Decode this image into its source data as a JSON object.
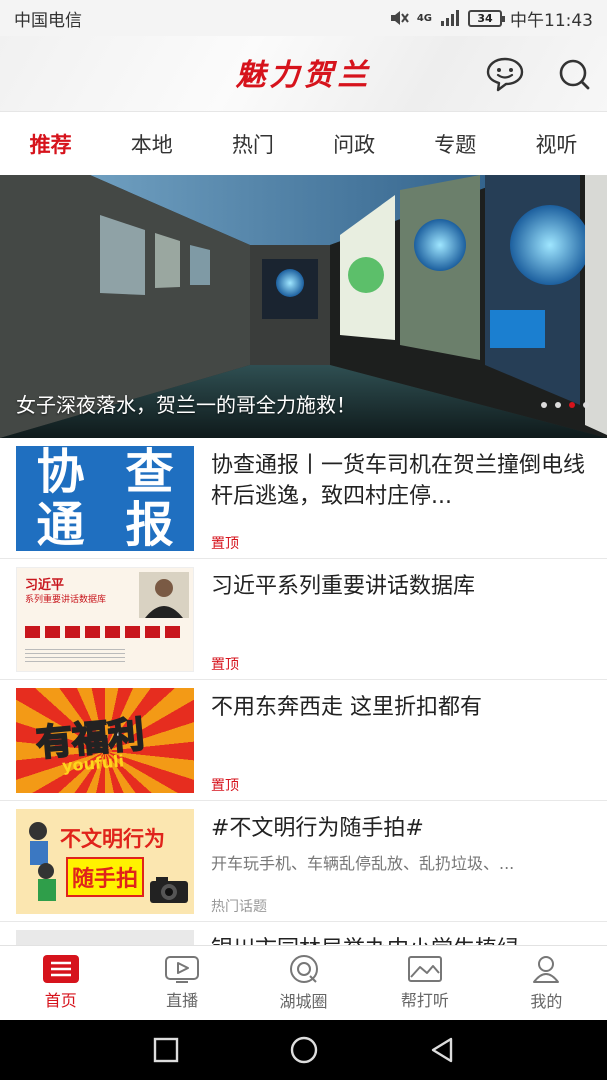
{
  "status_bar": {
    "carrier": "中国电信",
    "network": "4G",
    "battery": "34",
    "time": "中午11:43"
  },
  "header": {
    "logo_text": "魅力贺兰",
    "chat_icon": "chat-bubble-icon",
    "search_icon": "search-icon"
  },
  "tabs": [
    {
      "label": "推荐",
      "active": true
    },
    {
      "label": "本地"
    },
    {
      "label": "热门"
    },
    {
      "label": "问政"
    },
    {
      "label": "专题"
    },
    {
      "label": "视听"
    }
  ],
  "banner": {
    "caption": "女子深夜落水，贺兰一的哥全力施救！",
    "slides": 4,
    "active_slide": 3
  },
  "news": [
    {
      "title": "协查通报丨一货车司机在贺兰撞倒电线杆后逃逸，致四村庄停...",
      "tag": "置顶",
      "thumb_text": [
        "协",
        "查",
        "通",
        "报"
      ]
    },
    {
      "title": "习近平系列重要讲话数据库",
      "tag": "置顶",
      "thumb_text": [
        "习近平",
        "系列重要讲话数据库"
      ]
    },
    {
      "title": "不用东奔西走  这里折扣都有",
      "tag": "置顶",
      "thumb_text": [
        "有福利",
        "youfuli"
      ]
    },
    {
      "title": "#不文明行为随手拍#",
      "subtitle": "开车玩手机、车辆乱停乱放、乱扔垃圾、...",
      "tag": "热门话题",
      "thumb_text": [
        "不文明行为",
        "随手拍"
      ]
    },
    {
      "title": "银川市园林局举办中小学生植绿"
    }
  ],
  "bottom_nav": [
    {
      "label": "首页",
      "icon": "home-list-icon",
      "active": true
    },
    {
      "label": "直播",
      "icon": "live-play-icon"
    },
    {
      "label": "湖城圈",
      "icon": "circle-community-icon"
    },
    {
      "label": "帮打听",
      "icon": "picture-icon"
    },
    {
      "label": "我的",
      "icon": "user-icon"
    }
  ],
  "colors": {
    "accent": "#d6131c",
    "text": "#222222",
    "muted": "#999999"
  }
}
